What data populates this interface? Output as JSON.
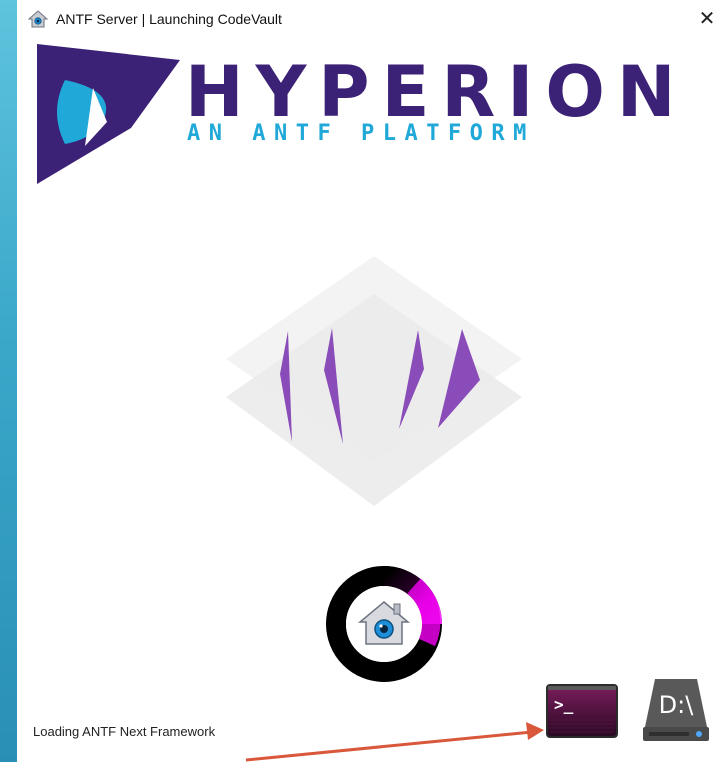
{
  "window": {
    "title": "ANTF Server | Launching CodeVault",
    "close_label": "✕"
  },
  "branding": {
    "wordmark": "HYPERION",
    "tagline": "AN ANTF PLATFORM"
  },
  "status": {
    "message": "Loading ANTF Next Framework"
  },
  "drive": {
    "label": "D:\\"
  },
  "colors": {
    "brand_purple": "#3b2277",
    "brand_cyan": "#20a9d8",
    "accent_magenta": "#e800e8",
    "arrow": "#d9573a"
  },
  "icons": [
    "home-icon",
    "close-icon",
    "terminal-icon",
    "drive-icon",
    "loading-spinner"
  ]
}
